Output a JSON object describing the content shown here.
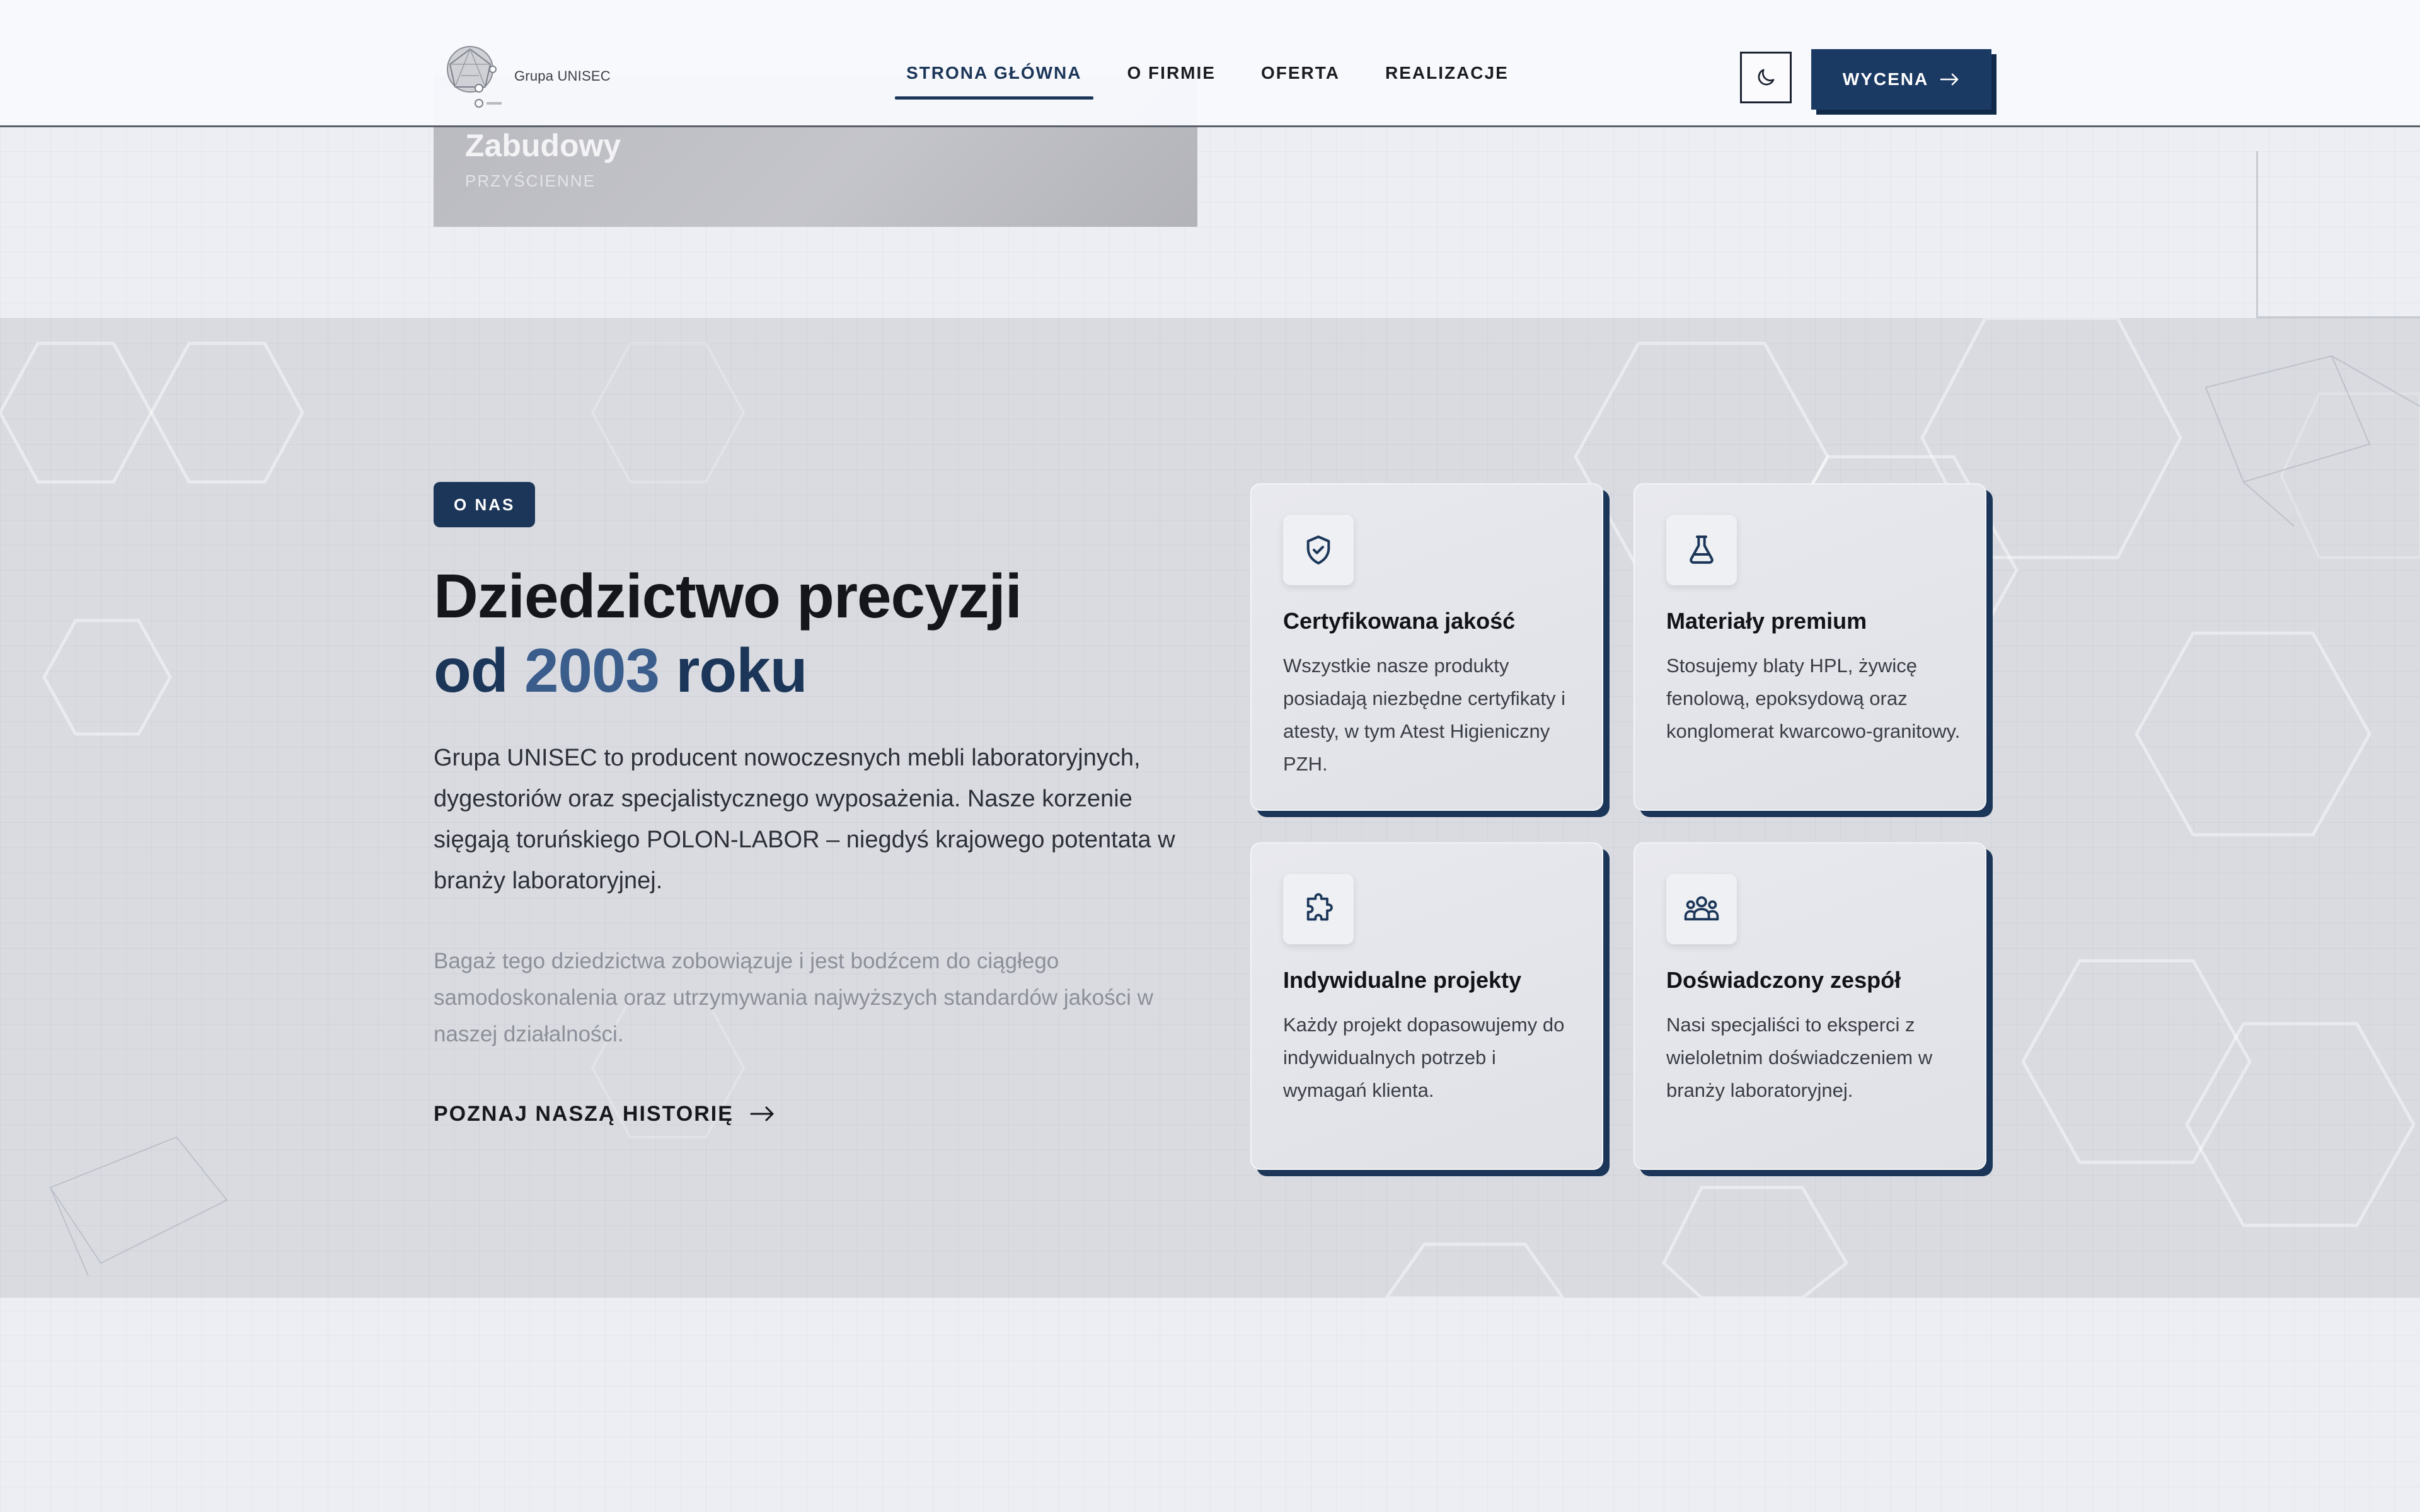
{
  "colors": {
    "brand_navy": "#1b3658",
    "accent_blue": "#3a5d8c",
    "section_bg": "#d9dbe1",
    "page_bg": "#eceef4"
  },
  "header": {
    "logo_text": "Grupa UNISEC",
    "nav": [
      {
        "label": "STRONA GŁÓWNA",
        "active": true
      },
      {
        "label": "O FIRMIE",
        "active": false
      },
      {
        "label": "OFERTA",
        "active": false
      },
      {
        "label": "REALIZACJE",
        "active": false
      }
    ],
    "theme_toggle_icon": "moon-icon",
    "quote_button": {
      "label": "WYCENA",
      "icon": "arrow-right-icon"
    }
  },
  "previous_card": {
    "title": "Zabudowy",
    "subtitle": "PRZYŚCIENNE"
  },
  "about": {
    "badge": "O NAS",
    "headline_line1": "Dziedzictwo precyzji",
    "headline_line2_prefix": "od ",
    "headline_line2_accent": "2003",
    "headline_line2_suffix": " roku",
    "lead": "Grupa UNISEC to producent nowoczesnych mebli laboratoryjnych, dygestoriów oraz specjalistycznego wyposażenia. Nasze korzenie sięgają toruńskiego POLON-LABOR – niegdyś krajowego potentata w branży laboratoryjnej.",
    "secondary": "Bagaż tego dziedzictwa zobowiązuje i jest bodźcem do ciągłego samodoskonalenia oraz utrzymywania najwyższych standardów jakości w naszej działalności.",
    "history_link": "POZNAJ NASZĄ HISTORIĘ",
    "history_link_icon": "arrow-right-icon",
    "features": [
      {
        "icon": "shield-check-icon",
        "title": "Certyfikowana jakość",
        "description": "Wszystkie nasze produkty posiadają niezbędne certyfikaty i atesty, w tym Atest Higieniczny PZH."
      },
      {
        "icon": "flask-icon",
        "title": "Materiały premium",
        "description": "Stosujemy blaty HPL, żywicę fenolową, epoksydową oraz konglomerat kwarcowo-granitowy."
      },
      {
        "icon": "puzzle-icon",
        "title": "Indywidualne projekty",
        "description": "Każdy projekt dopasowujemy do indywidualnych potrzeb i wymagań klienta."
      },
      {
        "icon": "users-icon",
        "title": "Doświadczony zespół",
        "description": "Nasi specjaliści to eksperci z wieloletnim doświadczeniem w branży laboratoryjnej."
      }
    ]
  }
}
